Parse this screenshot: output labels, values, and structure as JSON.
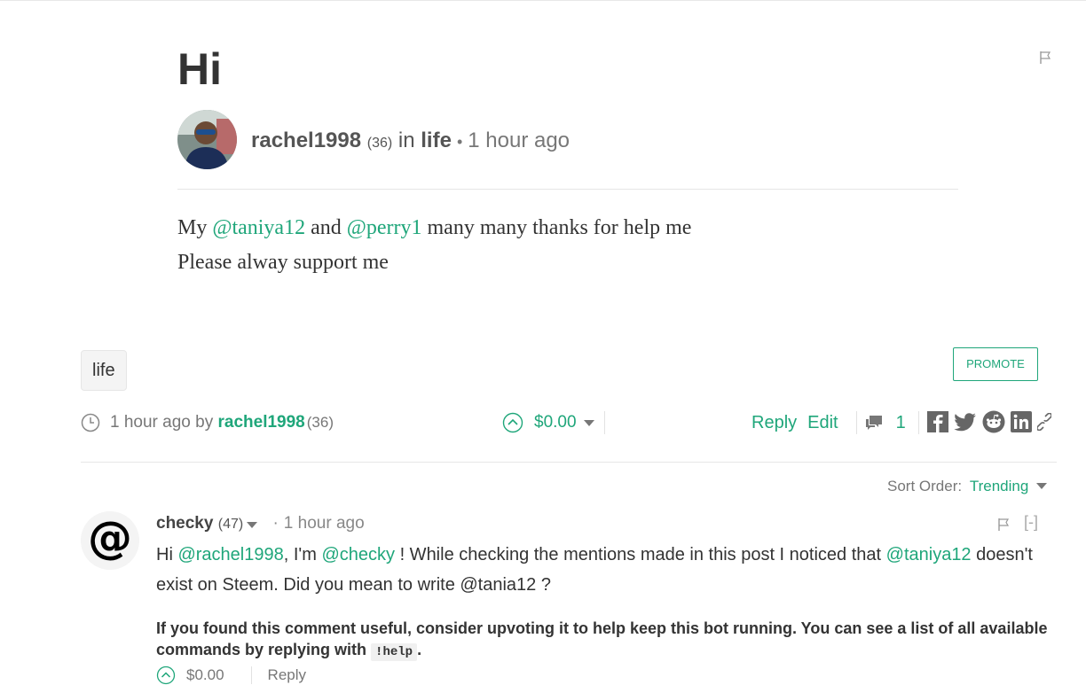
{
  "post": {
    "title": "Hi",
    "author": "rachel1998",
    "reputation": "(36)",
    "in_word": "in",
    "category": "life",
    "time": "1 hour ago",
    "body_line1": {
      "prefix": "My ",
      "mention1": "@taniya12",
      "middle": " and ",
      "mention2": "@perry1",
      "suffix": " many many thanks for help me"
    },
    "body_line2": "Please alway support me"
  },
  "tags": [
    "life"
  ],
  "promote_label": "PROMOTE",
  "footer": {
    "time": "1 hour ago",
    "by": "by",
    "author": "rachel1998",
    "reputation": "(36)",
    "payout": "$0.00",
    "reply": "Reply",
    "edit": "Edit",
    "comment_count": "1"
  },
  "sort": {
    "label": "Sort Order:",
    "value": "Trending"
  },
  "comment": {
    "author": "checky",
    "reputation": "(47)",
    "time": "1 hour ago",
    "collapse": "[-]",
    "text": {
      "p1": "Hi ",
      "m1": "@rachel1998",
      "p2": ", I'm ",
      "m2": "@checky",
      "p3": " ! While checking the mentions made in this post I noticed that ",
      "m3": "@taniya12",
      "p4": " doesn't exist on Steem. Did you mean to write @tania12 ?"
    },
    "note": {
      "text": "If you found this comment useful, consider upvoting it to help keep this bot running. You can see a list of all available commands by replying with ",
      "code": "!help",
      "end": "."
    },
    "payout": "$0.00",
    "reply": "Reply"
  },
  "colors": {
    "accent": "#1fa67a",
    "text": "#333333",
    "muted": "#777777"
  },
  "icons": [
    "flag-icon",
    "clock-icon",
    "upvote-icon",
    "caret-down-icon",
    "comment-icon",
    "facebook-icon",
    "twitter-icon",
    "reddit-icon",
    "linkedin-icon",
    "link-icon"
  ]
}
